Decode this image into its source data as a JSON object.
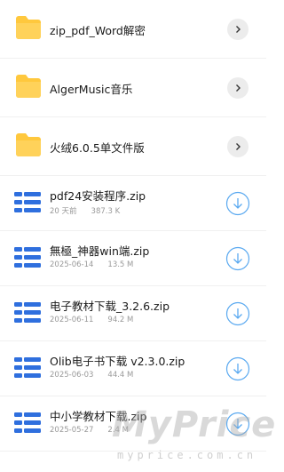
{
  "folders": [
    {
      "name": "zip_pdf_Word解密"
    },
    {
      "name": "AlgerMusic音乐"
    },
    {
      "name": "火绒6.0.5单文件版"
    }
  ],
  "files": [
    {
      "name": "pdf24安装程序.zip",
      "date": "20 天前",
      "size": "387.3 K"
    },
    {
      "name": "無極_神器win端.zip",
      "date": "2025-06-14",
      "size": "13.5 M"
    },
    {
      "name": "电子教材下载_3.2.6.zip",
      "date": "2025-06-11",
      "size": "94.2 M"
    },
    {
      "name": "Olib电子书下载 v2.3.0.zip",
      "date": "2025-06-03",
      "size": "44.4 M"
    },
    {
      "name": "中小学教材下载.zip",
      "date": "2025-05-27",
      "size": "2.4 M"
    }
  ],
  "watermark": {
    "brand": "MyPrice",
    "domain": "myprice.com.cn"
  },
  "colors": {
    "folder": "#FFC83D",
    "file_icon": "#2F6FDE",
    "download": "#5AA9F0"
  }
}
